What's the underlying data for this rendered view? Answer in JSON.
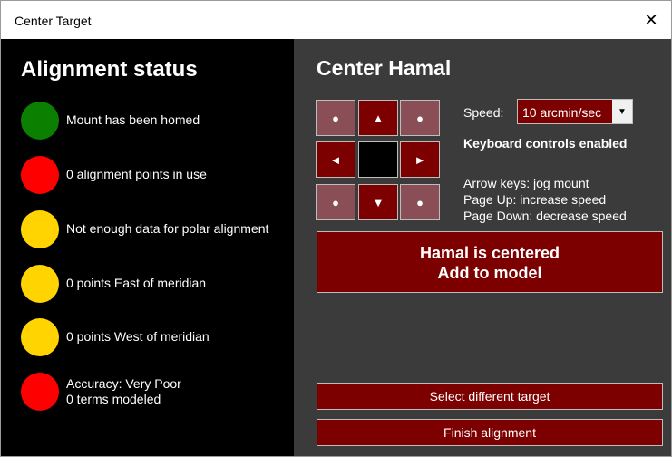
{
  "window": {
    "title": "Center Target",
    "close_glyph": "✕"
  },
  "alignment": {
    "heading": "Alignment status",
    "items": [
      {
        "color": "#0b8000",
        "text": "Mount has been homed",
        "text2": ""
      },
      {
        "color": "#ff0000",
        "text": "0 alignment points in use",
        "text2": ""
      },
      {
        "color": "#ffd400",
        "text": "Not enough data for polar alignment",
        "text2": ""
      },
      {
        "color": "#ffd400",
        "text": "0 points East of meridian",
        "text2": ""
      },
      {
        "color": "#ffd400",
        "text": "0 points West of meridian",
        "text2": ""
      },
      {
        "color": "#ff0000",
        "text": "Accuracy: Very Poor",
        "text2": "0 terms modeled"
      }
    ]
  },
  "center": {
    "heading": "Center Hamal",
    "jog": {
      "nw": "●",
      "up": "▲",
      "ne": "●",
      "left": "◄",
      "right": "►",
      "sw": "●",
      "down": "▼",
      "se": "●"
    },
    "speed": {
      "label": "Speed:",
      "value": "10 arcmin/sec"
    },
    "keyboard_enabled": "Keyboard controls enabled",
    "help": [
      "Arrow keys: jog mount",
      "Page Up: increase speed",
      "Page Down: decrease speed"
    ],
    "centered_button": {
      "line1": "Hamal is centered",
      "line2": "Add to model"
    },
    "select_target_label": "Select different target",
    "finish_label": "Finish alignment"
  },
  "colors": {
    "left_panel": "#000000",
    "right_panel": "#3b3b3b",
    "button_red": "#7d0000",
    "jog_dim": "#8a4f56"
  }
}
